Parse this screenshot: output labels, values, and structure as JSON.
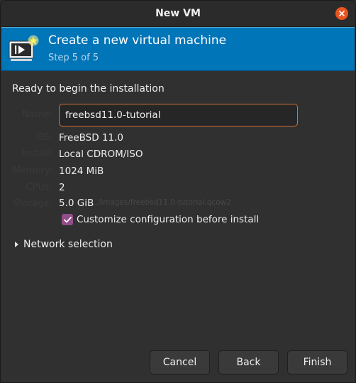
{
  "window": {
    "title": "New VM",
    "close_icon": "close-icon"
  },
  "header": {
    "title": "Create a new virtual machine",
    "step": "Step 5 of 5",
    "icon": "vm-icon"
  },
  "summary": {
    "heading": "Ready to begin the installation",
    "fields": {
      "name": {
        "label": "Name:",
        "value": "freebsd11.0-tutorial"
      },
      "os": {
        "label": "OS:",
        "value": "FreeBSD 11.0"
      },
      "install": {
        "label": "Install:",
        "value": "Local CDROM/ISO"
      },
      "memory": {
        "label": "Memory:",
        "value": "1024 MiB"
      },
      "cpus": {
        "label": "CPUs:",
        "value": "2"
      },
      "storage": {
        "label": "Storage:",
        "value": "5.0 GiB",
        "path": "../images/freebsd11.0-tutorial.qcow2"
      }
    },
    "customize": {
      "label": "Customize configuration before install",
      "checked": true
    }
  },
  "network": {
    "label": "Network selection",
    "expanded": false
  },
  "buttons": {
    "cancel": "Cancel",
    "back": "Back",
    "finish": "Finish"
  },
  "colors": {
    "accent": "#0075b8",
    "close": "#e95420",
    "checkbox": "#924d8b",
    "input_focus": "#d2703b"
  }
}
